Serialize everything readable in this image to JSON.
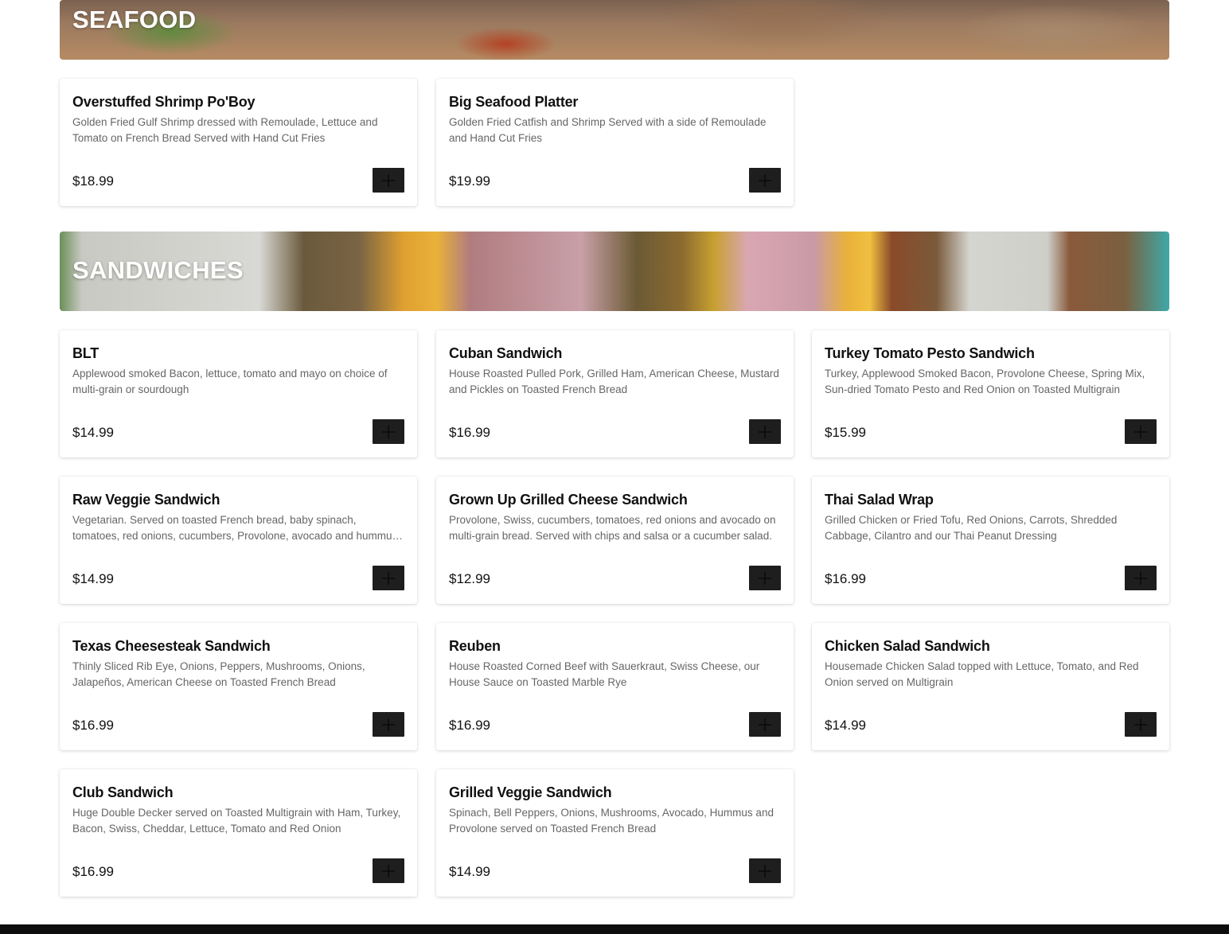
{
  "sections": {
    "seafood": {
      "title": "SEAFOOD",
      "items": [
        {
          "name": "Overstuffed Shrimp Po'Boy",
          "description": "Golden Fried Gulf Shrimp dressed with Remoulade, Lettuce and Tomato on French Bread Served with Hand Cut Fries",
          "price": "$18.99"
        },
        {
          "name": "Big Seafood Platter",
          "description": "Golden Fried Catfish and Shrimp Served with a side of Remoulade and Hand Cut Fries",
          "price": "$19.99"
        }
      ]
    },
    "sandwiches": {
      "title": "SANDWICHES",
      "items": [
        {
          "name": "BLT",
          "description": "Applewood smoked Bacon, lettuce, tomato and mayo on choice of multi-grain or sourdough",
          "price": "$14.99"
        },
        {
          "name": "Cuban Sandwich",
          "description": "House Roasted Pulled Pork, Grilled Ham, American Cheese, Mustard and Pickles on Toasted French Bread",
          "price": "$16.99"
        },
        {
          "name": "Turkey Tomato Pesto Sandwich",
          "description": "Turkey, Applewood Smoked Bacon, Provolone Cheese, Spring Mix, Sun-dried Tomato Pesto and Red Onion on Toasted Multigrain",
          "price": "$15.99"
        },
        {
          "name": "Raw Veggie Sandwich",
          "description": "Vegetarian. Served on toasted French bread, baby spinach, tomatoes, red onions, cucumbers, Provolone, avocado and hummus. Served wit...",
          "price": "$14.99"
        },
        {
          "name": "Grown Up Grilled Cheese Sandwich",
          "description": "Provolone, Swiss, cucumbers, tomatoes, red onions and avocado on multi-grain bread. Served with chips and salsa or a cucumber salad.",
          "price": "$12.99"
        },
        {
          "name": "Thai Salad Wrap",
          "description": "Grilled Chicken or Fried Tofu, Red Onions, Carrots, Shredded Cabbage, Cilantro and our Thai Peanut Dressing",
          "price": "$16.99"
        },
        {
          "name": "Texas Cheesesteak Sandwich",
          "description": "Thinly Sliced Rib Eye, Onions, Peppers, Mushrooms, Onions, Jalapeños, American Cheese on Toasted French Bread",
          "price": "$16.99"
        },
        {
          "name": "Reuben",
          "description": "House Roasted Corned Beef with Sauerkraut, Swiss Cheese, our House Sauce on Toasted Marble Rye",
          "price": "$16.99"
        },
        {
          "name": "Chicken Salad Sandwich",
          "description": "Housemade Chicken Salad topped with Lettuce, Tomato, and Red Onion served on Multigrain",
          "price": "$14.99"
        },
        {
          "name": "Club Sandwich",
          "description": "Huge Double Decker served on Toasted Multigrain with Ham, Turkey, Bacon, Swiss, Cheddar, Lettuce, Tomato and Red Onion",
          "price": "$16.99"
        },
        {
          "name": "Grilled Veggie Sandwich",
          "description": "Spinach, Bell Peppers, Onions, Mushrooms, Avocado, Hummus and Provolone served on Toasted French Bread",
          "price": "$14.99"
        }
      ]
    }
  },
  "icons": {
    "add": "plus-icon"
  },
  "colors": {
    "add_button_bg": "#1e1e1e",
    "price_text": "#111111",
    "description_text": "#666666",
    "footer_bar": "#0d0d0d"
  }
}
